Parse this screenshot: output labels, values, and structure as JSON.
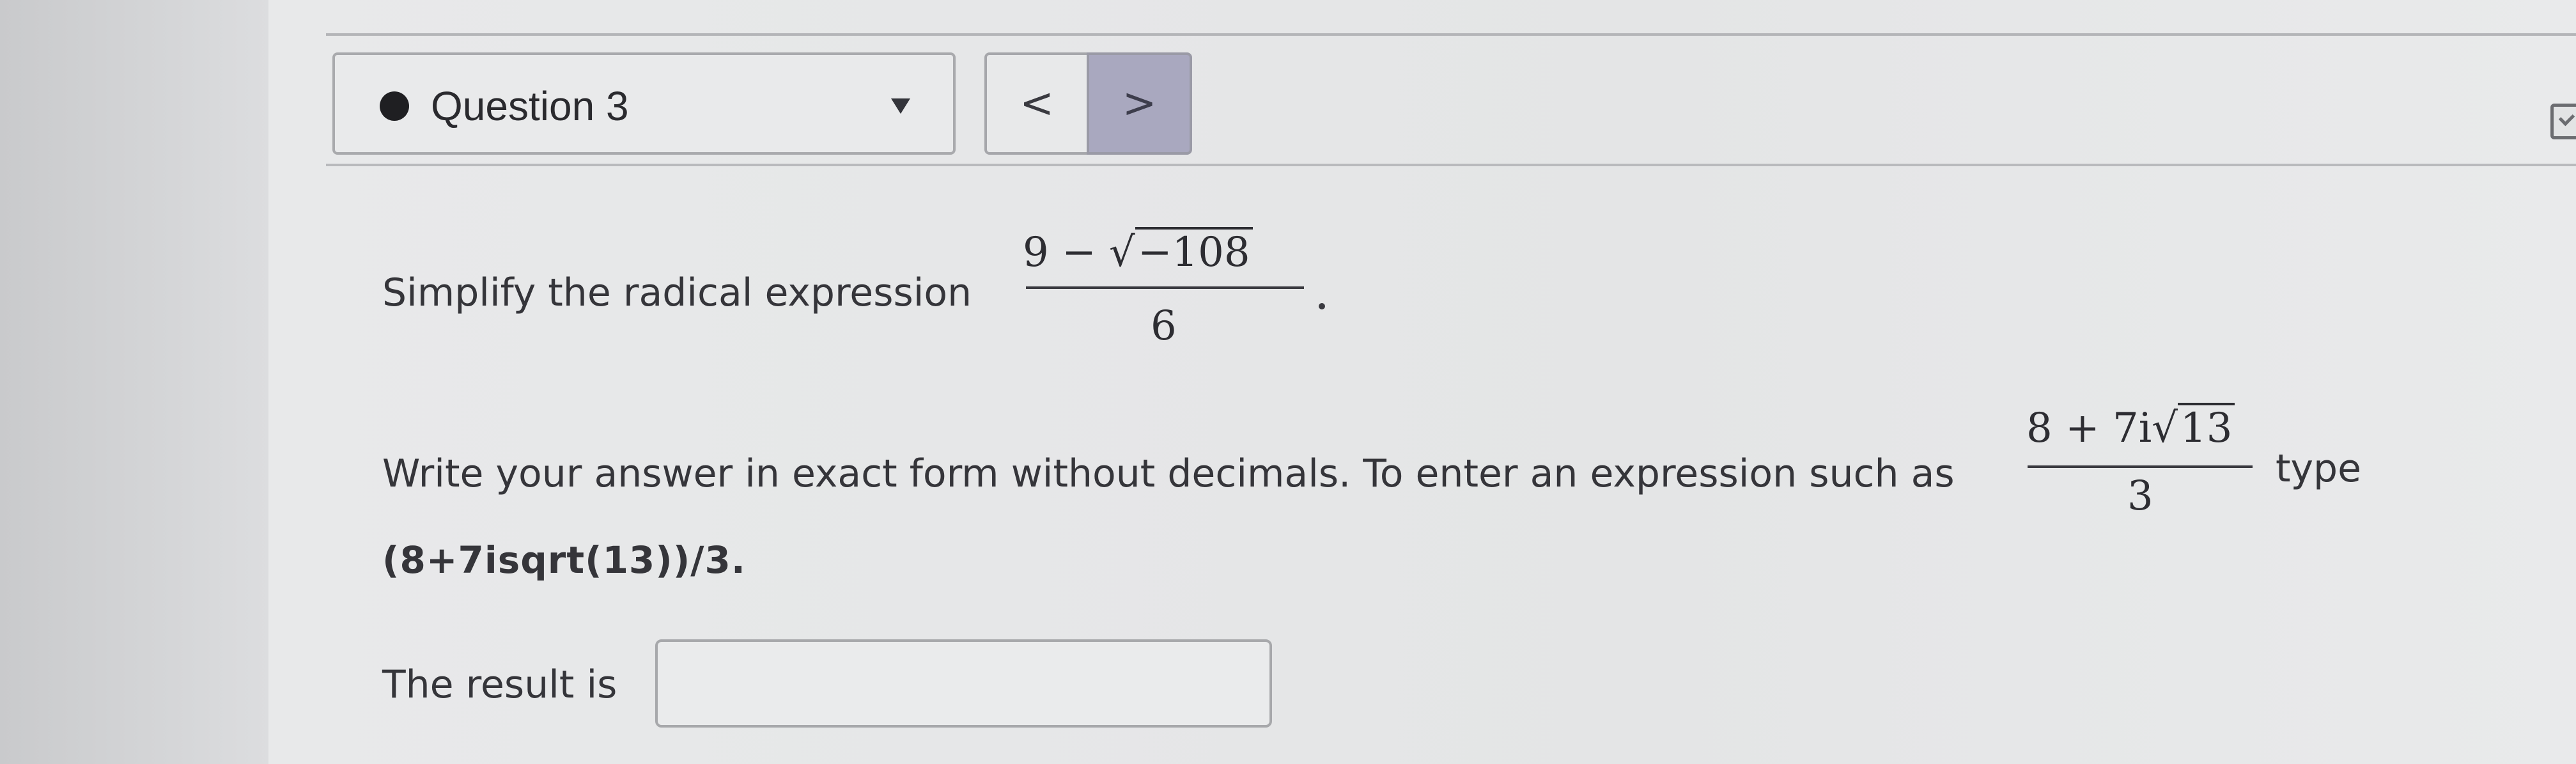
{
  "header": {
    "question_label": "Question 3",
    "prev_label": "<",
    "next_label": ">"
  },
  "problem": {
    "prompt": "Simplify the radical expression",
    "expr_num_prefix": "9 − ",
    "expr_num_radicand": "−108",
    "expr_den": "6",
    "period": "."
  },
  "instructions": {
    "text": "Write your answer in exact form without decimals. To enter an expression such as",
    "example_num_prefix": "8 + 7i",
    "example_num_radicand": "13",
    "example_den": "3",
    "type_word": "type",
    "typed_form": "(8+7isqrt(13))/3."
  },
  "answer": {
    "label": "The result is",
    "value": "",
    "placeholder": ""
  }
}
